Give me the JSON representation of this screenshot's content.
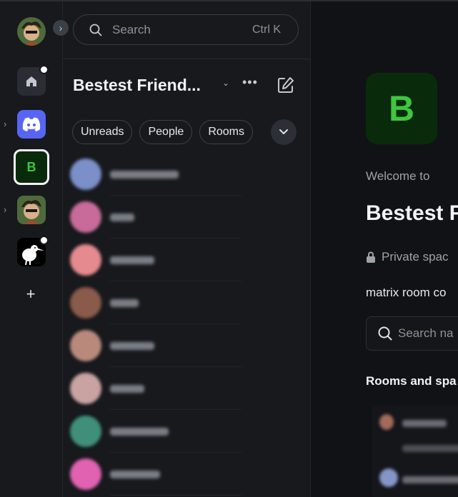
{
  "search": {
    "label": "Search",
    "shortcut": "Ctrl K"
  },
  "room_list": {
    "title": "Bestest Friend...",
    "filters": [
      "Unreads",
      "People",
      "Rooms"
    ],
    "rooms": [
      {
        "avatar_color": "#7b8fc8",
        "name_width": 96
      },
      {
        "avatar_color": "#c86b9a",
        "name_width": 34
      },
      {
        "avatar_color": "#e58a8f",
        "name_width": 62
      },
      {
        "avatar_color": "#8a5a4a",
        "name_width": 40
      },
      {
        "avatar_color": "#b98a7c",
        "name_width": 62
      },
      {
        "avatar_color": "#c9a2a2",
        "name_width": 48
      },
      {
        "avatar_color": "#3f8f7a",
        "name_width": 82
      },
      {
        "avatar_color": "#e062b0",
        "name_width": 70
      }
    ]
  },
  "space_bar": {
    "active_space_letter": "B"
  },
  "main": {
    "space_letter": "B",
    "welcome": "Welcome to",
    "space_name": "Bestest F",
    "privacy": "Private spac",
    "topic": "matrix room co",
    "search_placeholder": "Search na",
    "section_title": "Rooms and spa"
  },
  "colors": {
    "space_bg": "#0a2a0c",
    "space_letter": "#3fc63f",
    "discord": "#5865f2"
  }
}
